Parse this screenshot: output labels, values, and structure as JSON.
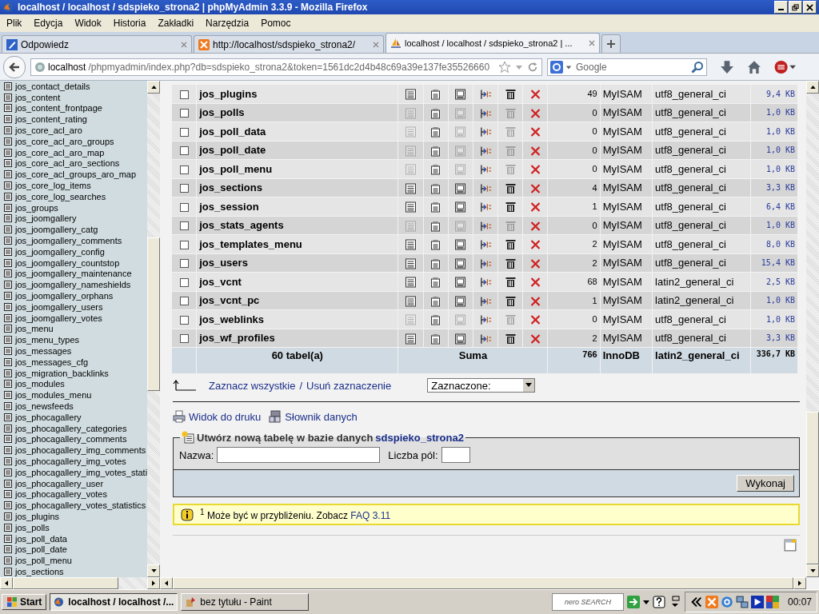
{
  "window": {
    "title": "localhost / localhost / sdspieko_strona2 | phpMyAdmin 3.3.9 - Mozilla Firefox"
  },
  "menu": [
    "Plik",
    "Edycja",
    "Widok",
    "Historia",
    "Zakładki",
    "Narzędzia",
    "Pomoc"
  ],
  "tabs": [
    {
      "label": "Odpowiedz",
      "kind": "edit",
      "selected": false
    },
    {
      "label": "http://localhost/sdspieko_strona2/",
      "kind": "xampp",
      "selected": false
    },
    {
      "label": "localhost / localhost / sdspieko_strona2 | ...",
      "kind": "pma",
      "selected": true
    }
  ],
  "address": {
    "host": "localhost",
    "path": "/phpmyadmin/index.php?db=sdspieko_strona2&token=1561dc2d4b48c69a39e137fe35526660"
  },
  "search": {
    "placeholder": "Google"
  },
  "sidebar": {
    "items": [
      "jos_contact_details",
      "jos_content",
      "jos_content_frontpage",
      "jos_content_rating",
      "jos_core_acl_aro",
      "jos_core_acl_aro_groups",
      "jos_core_acl_aro_map",
      "jos_core_acl_aro_sections",
      "jos_core_acl_groups_aro_map",
      "jos_core_log_items",
      "jos_core_log_searches",
      "jos_groups",
      "jos_joomgallery",
      "jos_joomgallery_catg",
      "jos_joomgallery_comments",
      "jos_joomgallery_config",
      "jos_joomgallery_countstop",
      "jos_joomgallery_maintenance",
      "jos_joomgallery_nameshields",
      "jos_joomgallery_orphans",
      "jos_joomgallery_users",
      "jos_joomgallery_votes",
      "jos_menu",
      "jos_menu_types",
      "jos_messages",
      "jos_messages_cfg",
      "jos_migration_backlinks",
      "jos_modules",
      "jos_modules_menu",
      "jos_newsfeeds",
      "jos_phocagallery",
      "jos_phocagallery_categories",
      "jos_phocagallery_comments",
      "jos_phocagallery_img_comments",
      "jos_phocagallery_img_votes",
      "jos_phocagallery_img_votes_stati",
      "jos_phocagallery_user",
      "jos_phocagallery_votes",
      "jos_phocagallery_votes_statistics",
      "jos_plugins",
      "jos_polls",
      "jos_poll_data",
      "jos_poll_date",
      "jos_poll_menu",
      "jos_sections"
    ]
  },
  "table": {
    "rows": [
      {
        "name": "jos_plugins",
        "checked": false,
        "actions_disabled": false,
        "records": "49",
        "engine": "MyISAM",
        "collation": "utf8_general_ci",
        "size": "9,4 KB"
      },
      {
        "name": "jos_polls",
        "checked": false,
        "actions_disabled": true,
        "records": "0",
        "engine": "MyISAM",
        "collation": "utf8_general_ci",
        "size": "1,0 KB"
      },
      {
        "name": "jos_poll_data",
        "checked": false,
        "actions_disabled": true,
        "records": "0",
        "engine": "MyISAM",
        "collation": "utf8_general_ci",
        "size": "1,0 KB"
      },
      {
        "name": "jos_poll_date",
        "checked": false,
        "actions_disabled": true,
        "records": "0",
        "engine": "MyISAM",
        "collation": "utf8_general_ci",
        "size": "1,0 KB"
      },
      {
        "name": "jos_poll_menu",
        "checked": false,
        "actions_disabled": true,
        "records": "0",
        "engine": "MyISAM",
        "collation": "utf8_general_ci",
        "size": "1,0 KB"
      },
      {
        "name": "jos_sections",
        "checked": false,
        "actions_disabled": false,
        "records": "4",
        "engine": "MyISAM",
        "collation": "utf8_general_ci",
        "size": "3,3 KB"
      },
      {
        "name": "jos_session",
        "checked": false,
        "actions_disabled": false,
        "records": "1",
        "engine": "MyISAM",
        "collation": "utf8_general_ci",
        "size": "6,4 KB"
      },
      {
        "name": "jos_stats_agents",
        "checked": false,
        "actions_disabled": true,
        "records": "0",
        "engine": "MyISAM",
        "collation": "utf8_general_ci",
        "size": "1,0 KB"
      },
      {
        "name": "jos_templates_menu",
        "checked": false,
        "actions_disabled": false,
        "records": "2",
        "engine": "MyISAM",
        "collation": "utf8_general_ci",
        "size": "8,0 KB"
      },
      {
        "name": "jos_users",
        "checked": false,
        "actions_disabled": false,
        "records": "2",
        "engine": "MyISAM",
        "collation": "utf8_general_ci",
        "size": "15,4 KB"
      },
      {
        "name": "jos_vcnt",
        "checked": false,
        "actions_disabled": false,
        "records": "68",
        "engine": "MyISAM",
        "collation": "latin2_general_ci",
        "size": "2,5 KB"
      },
      {
        "name": "jos_vcnt_pc",
        "checked": false,
        "actions_disabled": false,
        "records": "1",
        "engine": "MyISAM",
        "collation": "latin2_general_ci",
        "size": "1,0 KB"
      },
      {
        "name": "jos_weblinks",
        "checked": false,
        "actions_disabled": true,
        "records": "0",
        "engine": "MyISAM",
        "collation": "utf8_general_ci",
        "size": "1,0 KB"
      },
      {
        "name": "jos_wf_profiles",
        "checked": false,
        "actions_disabled": false,
        "records": "2",
        "engine": "MyISAM",
        "collation": "utf8_general_ci",
        "size": "3,3 KB"
      }
    ],
    "footer": {
      "count": "60 tabel(a)",
      "label": "Suma",
      "records": "766",
      "engine": "InnoDB",
      "collation": "latin2_general_ci",
      "size": "336,7 KB"
    }
  },
  "selection": {
    "check_all": "Zaznacz wszystkie",
    "separator": "/",
    "uncheck_all": "Usuń zaznaczenie",
    "dropdown": "Zaznaczone:"
  },
  "links": [
    "Widok do druku",
    "Słownik danych"
  ],
  "create_table": {
    "legend": "Utwórz nową tabelę w bazie danych",
    "database": "sdspieko_strona2",
    "name_label": "Nazwa:",
    "fields_label": "Liczba pól:",
    "button": "Wykonaj"
  },
  "notice": {
    "mark": "1",
    "text": "Może być w przybliżeniu. Zobacz",
    "link": "FAQ 3.11"
  },
  "taskbar": {
    "start": "Start",
    "tasks": [
      {
        "label": "localhost / localhost /...",
        "kind": "firefox",
        "selected": true
      },
      {
        "label": "bez tytułu - Paint",
        "kind": "paint",
        "selected": false
      }
    ],
    "search_logo": "nero SEARCH",
    "clock": "00:07"
  }
}
